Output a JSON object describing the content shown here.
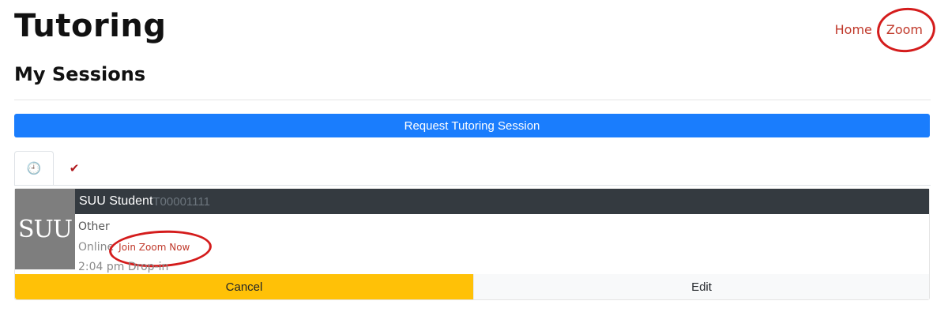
{
  "header": {
    "title": "Tutoring",
    "section_title": "My Sessions"
  },
  "nav": {
    "home_label": "Home",
    "zoom_label": "Zoom"
  },
  "actions": {
    "request_label": "Request Tutoring Session"
  },
  "tabs": [
    {
      "icon": "clock-icon",
      "glyph": "🕘",
      "active": true
    },
    {
      "icon": "checkmark-icon",
      "glyph": "✔",
      "active": false
    }
  ],
  "session": {
    "logo_text": "SUU",
    "student_name": "SUU Student",
    "student_id": "T00001111",
    "subject": "Other",
    "location": "Online",
    "join_label": "Join Zoom Now",
    "time": "2:04 pm Drop-in",
    "cancel_label": "Cancel",
    "edit_label": "Edit"
  },
  "colors": {
    "primary": "#1a7dfd",
    "warning": "#ffc107",
    "link": "#c0392b",
    "annotation": "#d41c1c",
    "dark_bar": "#343a40"
  }
}
